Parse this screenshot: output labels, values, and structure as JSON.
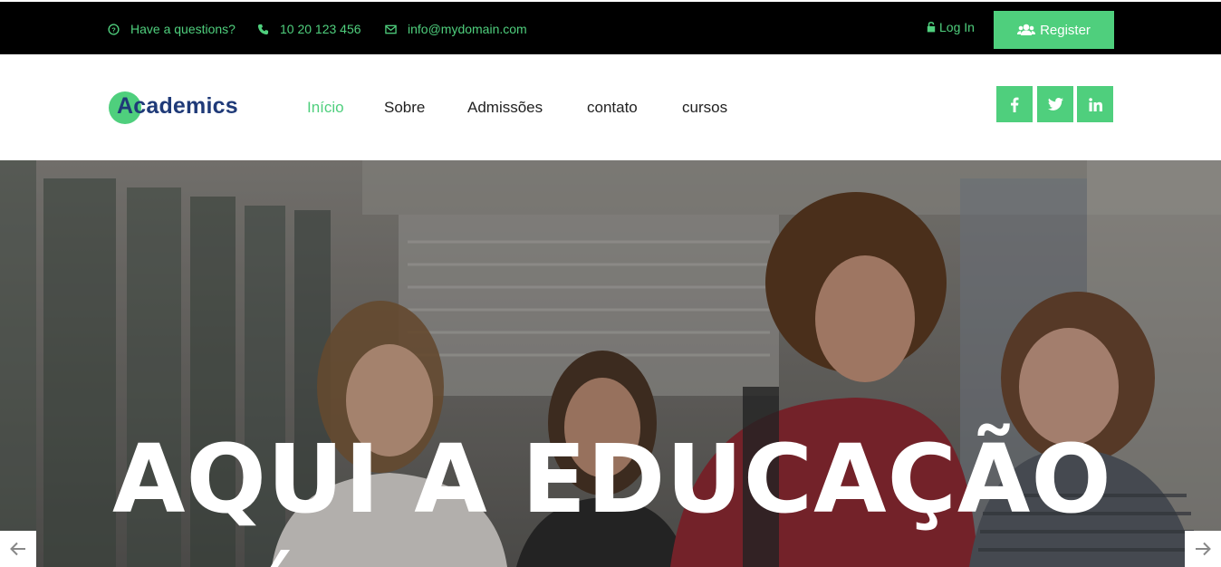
{
  "topbar": {
    "question": "Have a questions?",
    "phone": "10 20 123 456",
    "email": "info@mydomain.com",
    "login_label": "Log In",
    "register_label": "Register"
  },
  "header": {
    "logo_text": "Academics",
    "nav": [
      "Início",
      "Sobre",
      "Admissões",
      "contato",
      "cursos"
    ],
    "active_nav": "Início"
  },
  "social": [
    "facebook-icon",
    "twitter-icon",
    "linkedin-icon"
  ],
  "hero": {
    "headline": "AQUI A EDUCAÇÃO"
  },
  "colors": {
    "accent": "#4fcf7d",
    "brand": "#1f3a78",
    "topbar_bg": "#000000"
  }
}
